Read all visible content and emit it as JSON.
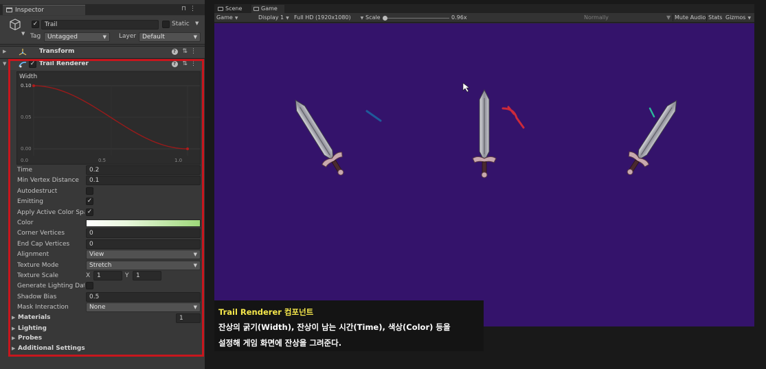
{
  "inspector": {
    "tab_label": "Inspector",
    "tab_icons": [
      "lock-icon",
      "kebab-menu-icon"
    ],
    "gameobject": {
      "active": true,
      "name": "Trail",
      "static_label": "Static",
      "static": false,
      "tag_label": "Tag",
      "tag_value": "Untagged",
      "layer_label": "Layer",
      "layer_value": "Default"
    },
    "transform": {
      "title": "Transform"
    },
    "trail_renderer": {
      "title": "Trail Renderer",
      "enabled": true,
      "highlight_color": "#c8161d",
      "width_curve": {
        "label": "Width",
        "y_ticks": [
          "0.10",
          "0.05",
          "0.00"
        ],
        "x_ticks": [
          "0.0",
          "0.5",
          "1.0"
        ],
        "start_value": 0.1,
        "end_value": 0.0,
        "curve_color": "#9a1a1a"
      },
      "properties": [
        {
          "label": "Time",
          "kind": "field",
          "value": "0.2"
        },
        {
          "label": "Min Vertex Distance",
          "kind": "field",
          "value": "0.1"
        },
        {
          "label": "Autodestruct",
          "kind": "checkbox",
          "checked": false
        },
        {
          "label": "Emitting",
          "kind": "checkbox",
          "checked": true
        },
        {
          "label": "Apply Active Color Space",
          "kind": "checkbox",
          "checked": true
        },
        {
          "label": "Color",
          "kind": "gradient"
        },
        {
          "label": "Corner Vertices",
          "kind": "field",
          "value": "0"
        },
        {
          "label": "End Cap Vertices",
          "kind": "field",
          "value": "0"
        },
        {
          "label": "Alignment",
          "kind": "dropdown",
          "value": "View"
        },
        {
          "label": "Texture Mode",
          "kind": "dropdown",
          "value": "Stretch"
        },
        {
          "label": "Texture Scale",
          "kind": "vector2",
          "x_label": "X",
          "x": "1",
          "y_label": "Y",
          "y": "1"
        },
        {
          "label": "Generate Lighting Data",
          "kind": "checkbox",
          "checked": false
        },
        {
          "label": "Shadow Bias",
          "kind": "field",
          "value": "0.5"
        },
        {
          "label": "Mask Interaction",
          "kind": "dropdown",
          "value": "None"
        }
      ],
      "sections": [
        {
          "label": "Materials",
          "count": "1"
        },
        {
          "label": "Lighting"
        },
        {
          "label": "Probes"
        },
        {
          "label": "Additional Settings"
        }
      ],
      "color_gradient": [
        "#ffffff",
        "#e8f6dc",
        "#9ed87a"
      ]
    }
  },
  "game": {
    "tabs": [
      {
        "label": "Scene",
        "active": false
      },
      {
        "label": "Game",
        "active": true
      }
    ],
    "toolbar": {
      "display_mode": "Game",
      "display": "Display 1",
      "resolution": "Full HD (1920x1080)",
      "scale_label": "Scale",
      "scale_value": "0.96x",
      "play_mode": "Normally",
      "mute_audio": "Mute Audio",
      "stats": "Stats",
      "gizmos": "Gizmos"
    },
    "background_color": "#34136b",
    "swords": [
      "tilted-left",
      "upright",
      "tilted-right"
    ],
    "trail_colors": [
      "#1f5a9a",
      "#cc2a3a",
      "#2ab89a"
    ]
  },
  "caption": {
    "title": "Trail Renderer 컴포넌트",
    "line1": "잔상의 굵기(Width), 잔상이 남는 시간(Time), 색상(Color) 등을",
    "line2": "설정해 게임 화면에 잔상을 그려준다."
  }
}
